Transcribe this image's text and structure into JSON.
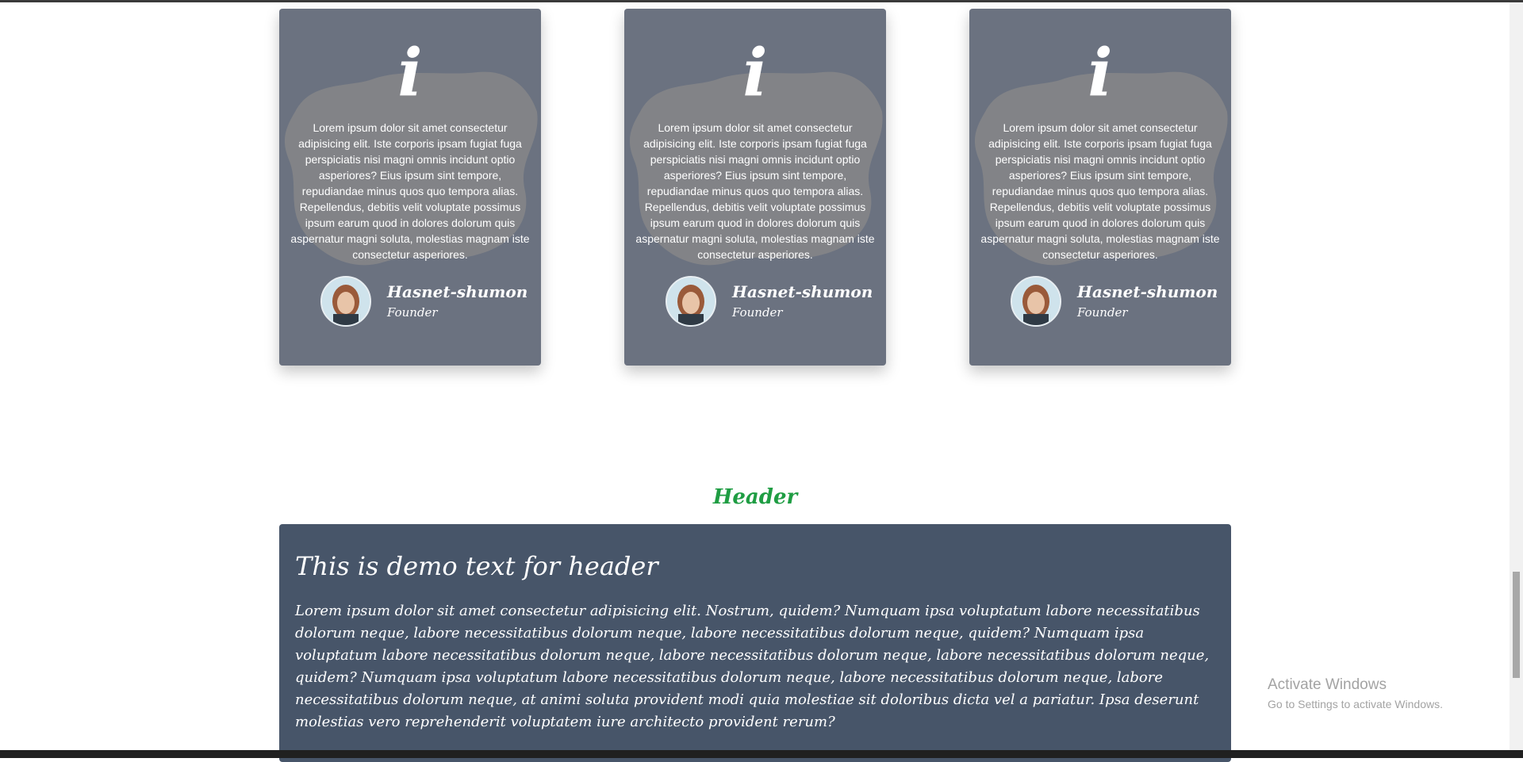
{
  "testimonials": [
    {
      "icon": "info-icon",
      "glyph": "i",
      "text": "Lorem ipsum dolor sit amet consectetur adipisicing elit. Iste corporis ipsam fugiat fuga perspiciatis nisi magni omnis incidunt optio asperiores? Eius ipsum sint tempore, repudiandae minus quos quo tempora alias. Repellendus, debitis velit voluptate possimus ipsum earum quod in dolores dolorum quis aspernatur magni soluta, molestias magnam iste consectetur asperiores.",
      "author": "Hasnet-shumon",
      "role": "Founder"
    },
    {
      "icon": "info-icon",
      "glyph": "i",
      "text": "Lorem ipsum dolor sit amet consectetur adipisicing elit. Iste corporis ipsam fugiat fuga perspiciatis nisi magni omnis incidunt optio asperiores? Eius ipsum sint tempore, repudiandae minus quos quo tempora alias. Repellendus, debitis velit voluptate possimus ipsum earum quod in dolores dolorum quis aspernatur magni soluta, molestias magnam iste consectetur asperiores.",
      "author": "Hasnet-shumon",
      "role": "Founder"
    },
    {
      "icon": "info-icon",
      "glyph": "i",
      "text": "Lorem ipsum dolor sit amet consectetur adipisicing elit. Iste corporis ipsam fugiat fuga perspiciatis nisi magni omnis incidunt optio asperiores? Eius ipsum sint tempore, repudiandae minus quos quo tempora alias. Repellendus, debitis velit voluptate possimus ipsum earum quod in dolores dolorum quis aspernatur magni soluta, molestias magnam iste consectetur asperiores.",
      "author": "Hasnet-shumon",
      "role": "Founder"
    }
  ],
  "header_section": {
    "heading": "Header",
    "title": "This is demo text for header",
    "body": "Lorem ipsum dolor sit amet consectetur adipisicing elit. Nostrum, quidem? Numquam ipsa voluptatum labore necessitatibus dolorum neque, labore necessitatibus dolorum neque, labore necessitatibus dolorum neque, quidem? Numquam ipsa voluptatum labore necessitatibus dolorum neque, labore necessitatibus dolorum neque, labore necessitatibus dolorum neque, quidem? Numquam ipsa voluptatum labore necessitatibus dolorum neque, labore necessitatibus dolorum neque, labore necessitatibus dolorum neque, at animi soluta provident modi quia molestiae sit doloribus dicta vel a pariatur. Ipsa deserunt molestias vero reprehenderit voluptatem iure architecto provident rerum?"
  },
  "watermark": {
    "title": "Activate Windows",
    "subtitle": "Go to Settings to activate Windows."
  },
  "colors": {
    "card_bg": "#6b7280",
    "header_box_bg": "#475569",
    "heading_green": "#1f9d43"
  }
}
